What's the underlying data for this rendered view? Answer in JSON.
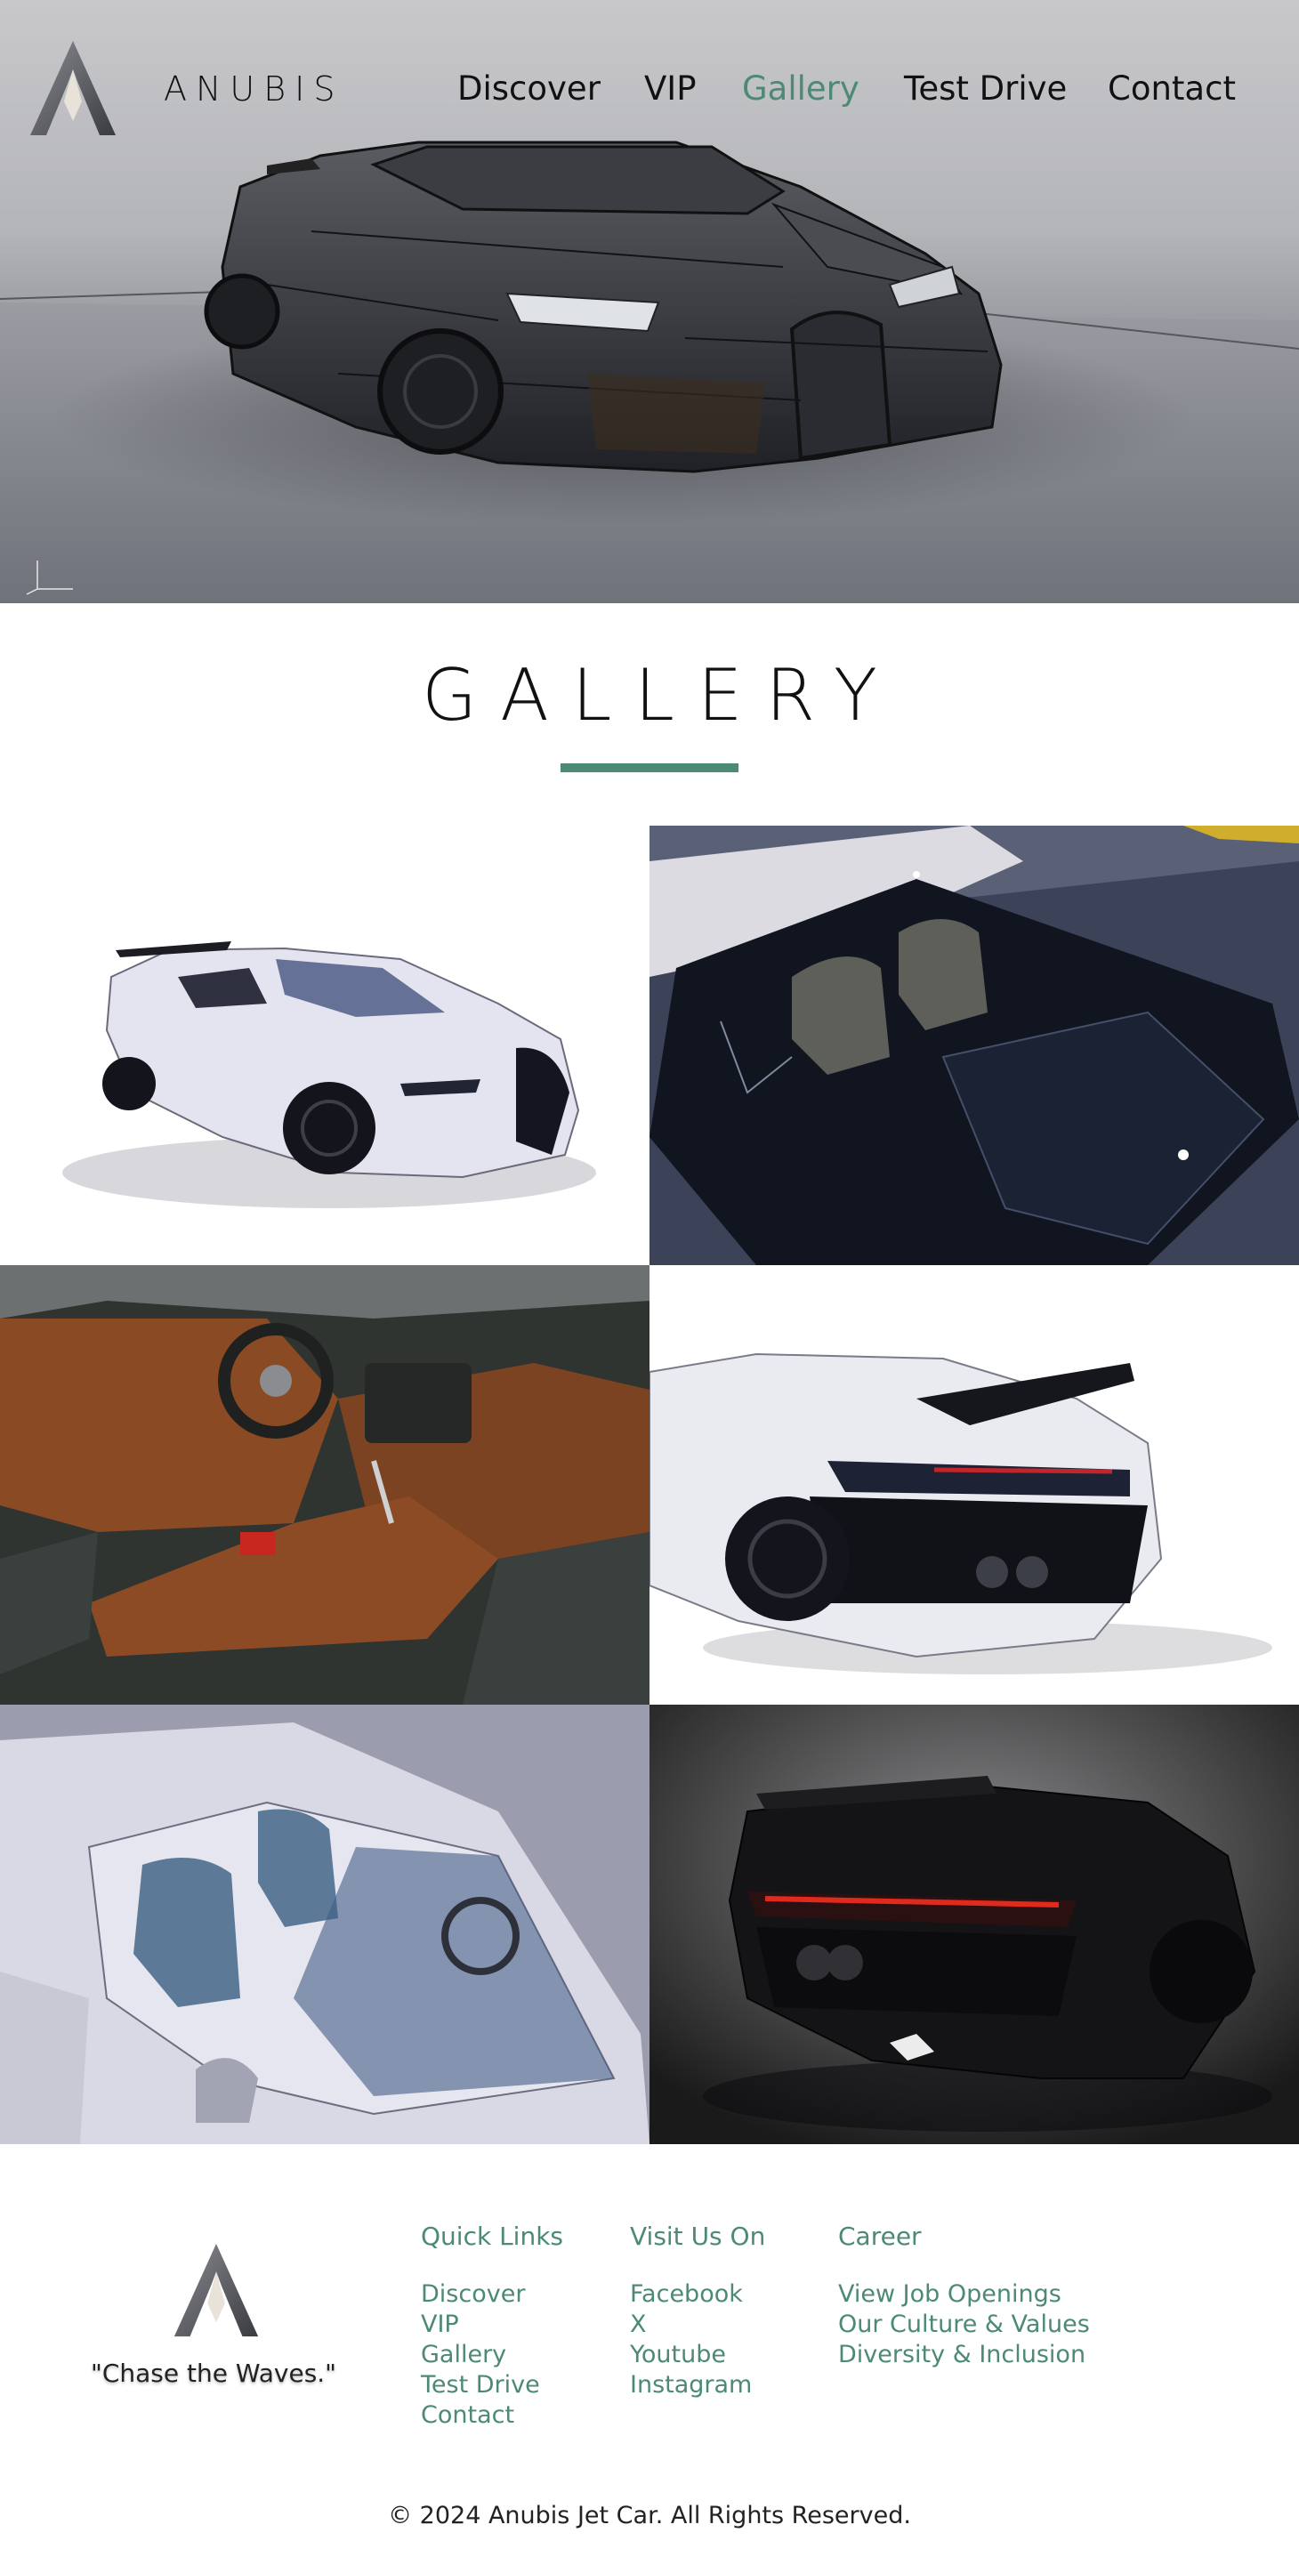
{
  "brand": {
    "name": "ANUBIS",
    "accent_color": "#4c8a73"
  },
  "nav": {
    "items": [
      {
        "label": "Discover",
        "active": false
      },
      {
        "label": "VIP",
        "active": false
      },
      {
        "label": "Gallery",
        "active": true
      },
      {
        "label": "Test Drive",
        "active": false
      },
      {
        "label": "Contact",
        "active": false
      }
    ]
  },
  "hero": {
    "image": "wireframe-render-of-dark-hypercar"
  },
  "gallery": {
    "title": "GALLERY",
    "images": [
      "white-roadster-front-three-quarter",
      "dark-roadster-top-view-interior",
      "brown-leather-interior-console",
      "white-hypercar-rear-with-wing",
      "white-roadster-cockpit-close-up",
      "black-hypercar-rear-dark-studio"
    ]
  },
  "footer": {
    "tagline": "\"Chase the Waves.\"",
    "quick_links": {
      "heading": "Quick Links",
      "items": [
        "Discover",
        "VIP",
        "Gallery",
        "Test Drive",
        "Contact"
      ]
    },
    "visit_us": {
      "heading": "Visit Us On",
      "items": [
        "Facebook",
        "X",
        "Youtube",
        "Instagram"
      ]
    },
    "career": {
      "heading": "Career",
      "items": [
        "View Job Openings",
        "Our Culture & Values",
        "Diversity & Inclusion"
      ]
    },
    "copyright": "© 2024 Anubis Jet Car. All Rights Reserved."
  }
}
